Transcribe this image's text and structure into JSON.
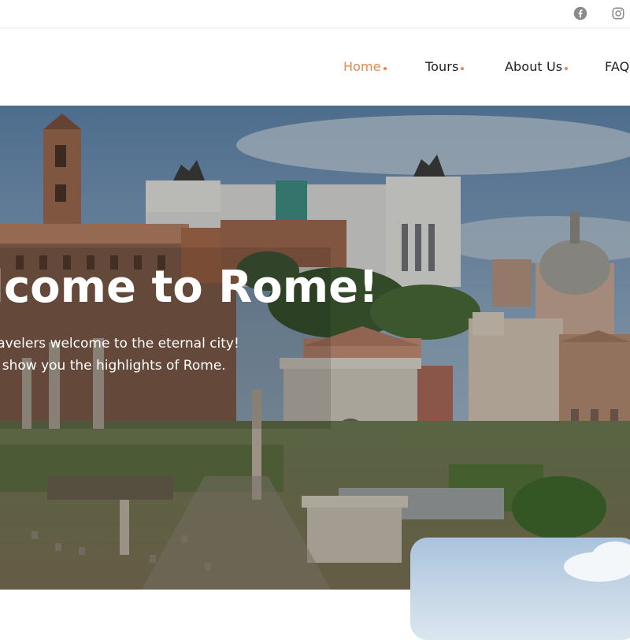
{
  "social": {
    "icons": [
      "facebook-icon",
      "instagram-icon"
    ]
  },
  "nav": {
    "items": [
      {
        "label": "Home",
        "active": true
      },
      {
        "label": "Tours",
        "active": false
      },
      {
        "label": "About Us",
        "active": false
      },
      {
        "label": "FAQ",
        "active": false
      }
    ]
  },
  "hero": {
    "title": "Welcome to Rome!",
    "line1": "Our travelers welcome to the eternal city!",
    "line2": "Let us show you the highlights of Rome."
  },
  "colors": {
    "accent": "#e8874d",
    "text": "#1f1f1f"
  }
}
